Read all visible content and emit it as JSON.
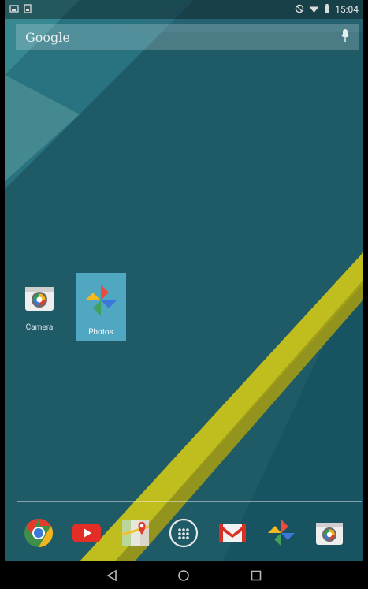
{
  "status_bar": {
    "time": "15:04",
    "left_icons": [
      "screenshot-icon",
      "sim-icon"
    ],
    "right_icons": [
      "do-not-disturb-icon",
      "wifi-icon",
      "battery-icon"
    ]
  },
  "search": {
    "logo_text": "Google",
    "mic_icon": "mic-icon"
  },
  "home_apps": [
    {
      "name": "Camera",
      "icon": "camera-icon",
      "selected": false
    },
    {
      "name": "Photos",
      "icon": "photos-pinwheel-icon",
      "selected": true
    }
  ],
  "dock": [
    {
      "icon": "chrome-icon"
    },
    {
      "icon": "youtube-icon"
    },
    {
      "icon": "maps-icon"
    },
    {
      "icon": "app-drawer-icon"
    },
    {
      "icon": "gmail-icon"
    },
    {
      "icon": "photos-pinwheel-icon"
    },
    {
      "icon": "camera-icon"
    }
  ],
  "nav_bar": [
    "back-icon",
    "home-icon",
    "recents-icon"
  ],
  "colors": {
    "wallpaper_base": "#1d5563",
    "selected_tile": "#4fa7c2",
    "yellow_stripe": "#c9c41b"
  }
}
